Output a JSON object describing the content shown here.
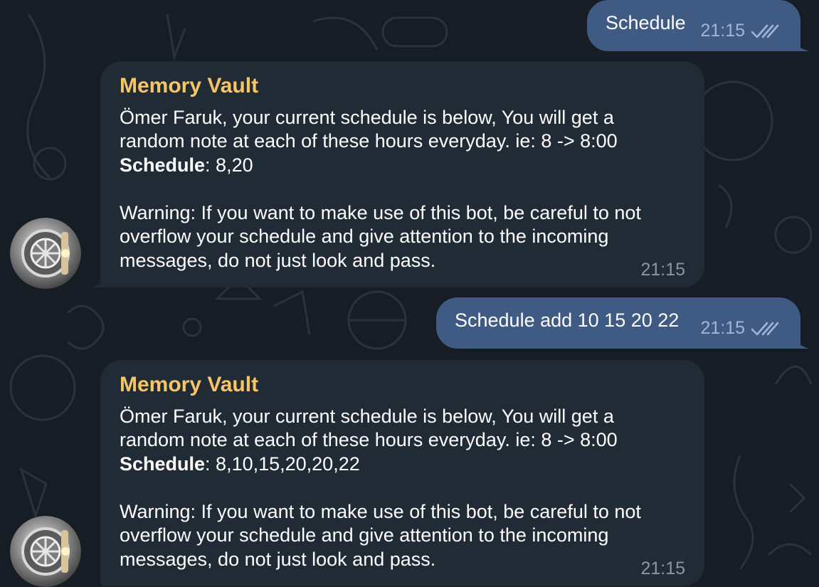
{
  "chat": {
    "messages": [
      {
        "kind": "outgoing",
        "text": "Schedule",
        "time": "21:15",
        "status_icon": "double-check-icon"
      },
      {
        "kind": "incoming",
        "sender": "Memory Vault",
        "lines": [
          "Ömer Faruk, your current schedule is below, You will get a",
          "random note at each of these hours everyday. ie: 8 -> 8:00"
        ],
        "schedule_label": "Schedule",
        "schedule_value": ": 8,20",
        "warning_lines": [
          "Warning: If you want to make use of this bot, be careful to not",
          "overflow your schedule and give attention to the incoming",
          "messages, do not just look and pass."
        ],
        "time": "21:15"
      },
      {
        "kind": "outgoing",
        "text": "Schedule add 10 15 20 22",
        "time": "21:15",
        "status_icon": "double-check-icon"
      },
      {
        "kind": "incoming",
        "sender": "Memory Vault",
        "lines": [
          "Ömer Faruk, your current schedule is below, You will get a",
          "random note at each of these hours everyday. ie: 8 -> 8:00"
        ],
        "schedule_label": "Schedule",
        "schedule_value": ": 8,10,15,20,20,22",
        "warning_lines": [
          "Warning: If you want to make use of this bot, be careful to not",
          "overflow your schedule and give attention to the incoming",
          "messages, do not just look and pass."
        ],
        "time": "21:15"
      }
    ]
  },
  "colors": {
    "background": "#161d25",
    "outgoing_bubble": "#3f5b84",
    "incoming_bubble": "#212b36",
    "sender_name": "#f5c566"
  },
  "icons": {
    "avatar": "bank-vault-door-avatar",
    "read_status": "double-check-icon"
  }
}
